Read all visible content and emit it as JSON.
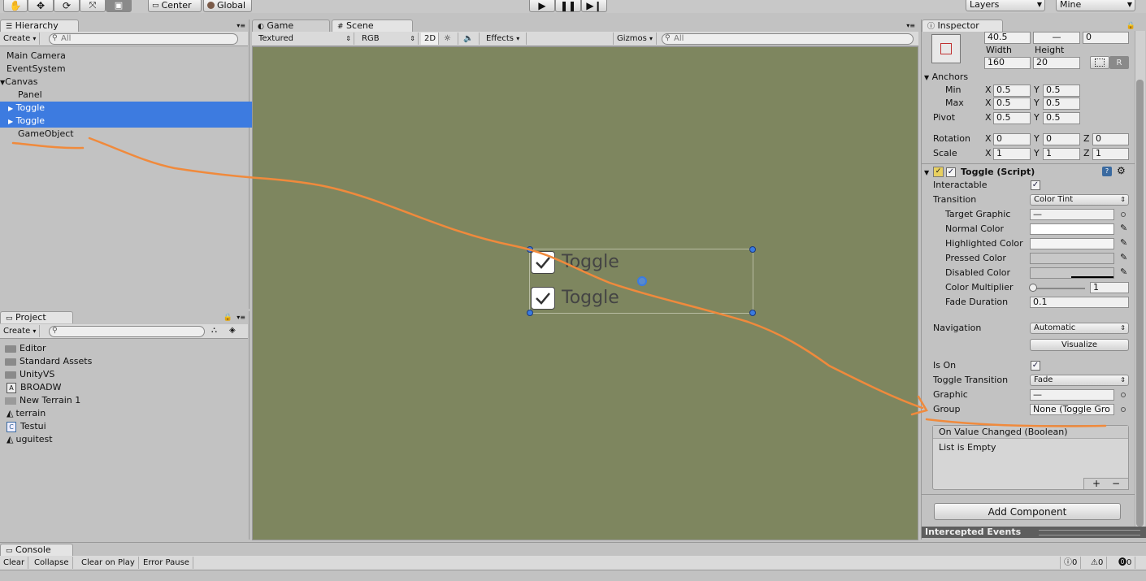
{
  "toolbar": {
    "center_label": "Center",
    "global_label": "Global",
    "layers_label": "Layers",
    "layout_label": "Mine",
    "play_icon": "play-icon",
    "pause_icon": "pause-icon",
    "step_icon": "step-icon"
  },
  "hierarchy": {
    "tab": "Hierarchy",
    "create": "Create",
    "search_placeholder": "All",
    "items": [
      {
        "label": "Main Camera"
      },
      {
        "label": "EventSystem"
      },
      {
        "label": "Canvas"
      },
      {
        "label": "Panel"
      },
      {
        "label": "Toggle"
      },
      {
        "label": "Toggle"
      },
      {
        "label": "GameObject"
      }
    ]
  },
  "project": {
    "tab": "Project",
    "create": "Create",
    "items": [
      {
        "label": "Editor"
      },
      {
        "label": "Standard Assets"
      },
      {
        "label": "UnityVS"
      },
      {
        "label": "BROADW"
      },
      {
        "label": "New Terrain 1"
      },
      {
        "label": "terrain"
      },
      {
        "label": "Testui"
      },
      {
        "label": "uguitest"
      }
    ]
  },
  "views": {
    "game_tab": "Game",
    "scene_tab": "Scene",
    "textured": "Textured",
    "rgb": "RGB",
    "two_d": "2D",
    "effects": "Effects",
    "gizmos": "Gizmos",
    "search_placeholder": "All",
    "background_color": "#7e865f",
    "toggle1": "Toggle",
    "toggle2": "Toggle"
  },
  "inspector": {
    "tab": "Inspector",
    "pos_values": [
      "40.5",
      "—",
      "0"
    ],
    "width_label": "Width",
    "height_label": "Height",
    "width": "160",
    "height": "20",
    "r_label": "R",
    "anchors_label": "Anchors",
    "min_label": "Min",
    "max_label": "Max",
    "pivot_label": "Pivot",
    "rotation_label": "Rotation",
    "scale_label": "Scale",
    "axis_x": "X",
    "axis_y": "Y",
    "axis_z": "Z",
    "min_x": "0.5",
    "min_y": "0.5",
    "max_x": "0.5",
    "max_y": "0.5",
    "pivot_x": "0.5",
    "pivot_y": "0.5",
    "rot_x": "0",
    "rot_y": "0",
    "rot_z": "0",
    "scale_x": "1",
    "scale_y": "1",
    "scale_z": "1",
    "component_title": "Toggle (Script)",
    "interactable_label": "Interactable",
    "transition_label": "Transition",
    "transition_value": "Color Tint",
    "target_graphic_label": "Target Graphic",
    "target_graphic_value": "—",
    "normal_color_label": "Normal Color",
    "highlighted_color_label": "Highlighted Color",
    "pressed_color_label": "Pressed Color",
    "disabled_color_label": "Disabled Color",
    "color_multiplier_label": "Color Multiplier",
    "color_multiplier_value": "1",
    "fade_duration_label": "Fade Duration",
    "fade_duration_value": "0.1",
    "navigation_label": "Navigation",
    "navigation_value": "Automatic",
    "visualize_label": "Visualize",
    "is_on_label": "Is On",
    "toggle_transition_label": "Toggle Transition",
    "toggle_transition_value": "Fade",
    "graphic_label": "Graphic",
    "graphic_value": "—",
    "group_label": "Group",
    "group_value": "None (Toggle Gro",
    "event_title": "On Value Changed (Boolean)",
    "event_empty": "List is Empty",
    "add_component": "Add Component",
    "intercepted_events": "Intercepted Events",
    "colors": {
      "normal": "#ffffff",
      "highlighted": "#f5f5f5",
      "pressed": "#c8c8c8",
      "disabled": "#c8c8c8"
    }
  },
  "console": {
    "tab": "Console",
    "clear": "Clear",
    "collapse": "Collapse",
    "clear_on_play": "Clear on Play",
    "error_pause": "Error Pause",
    "info_count": "0",
    "warn_count": "0",
    "error_count": "0"
  },
  "annotation": {
    "stroke_color": "#f08a3c"
  }
}
